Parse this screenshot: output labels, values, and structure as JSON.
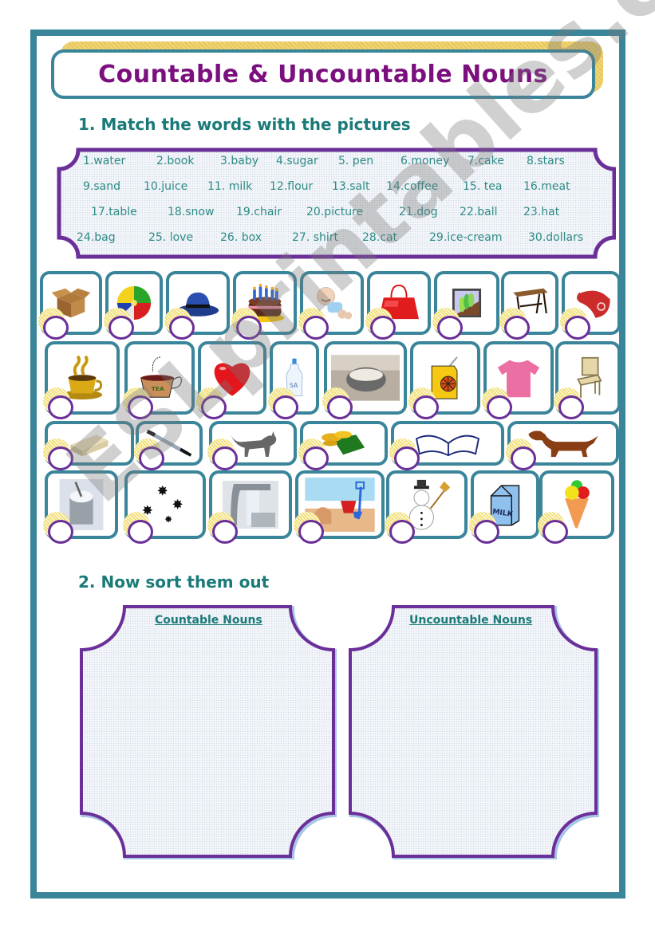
{
  "title": "Countable & Uncountable Nouns",
  "section1": {
    "heading": "1. Match the words with the pictures",
    "words": [
      [
        "1.water",
        "2.book",
        "3.baby",
        "4.sugar",
        "5. pen",
        "6.money",
        "7.cake",
        "8.stars"
      ],
      [
        "9.sand",
        "10.juice",
        "11. milk",
        "12.flour",
        "13.salt",
        "14.coffee",
        "15. tea",
        "16.meat"
      ],
      [
        "17.table",
        "18.snow",
        "19.chair",
        "20.picture",
        "21.dog",
        "22.ball",
        "23.hat"
      ],
      [
        "24.bag",
        "25. love",
        "26. box",
        "27. shirt",
        "28.cat",
        "29.ice-cream",
        "30.dollars"
      ]
    ],
    "pictures": [
      {
        "id": "box",
        "label": "box"
      },
      {
        "id": "ball",
        "label": "ball"
      },
      {
        "id": "hat",
        "label": "hat"
      },
      {
        "id": "cake",
        "label": "cake"
      },
      {
        "id": "baby",
        "label": "baby"
      },
      {
        "id": "bag",
        "label": "bag"
      },
      {
        "id": "picture",
        "label": "picture"
      },
      {
        "id": "table",
        "label": "table"
      },
      {
        "id": "meat",
        "label": "meat"
      },
      {
        "id": "coffee",
        "label": "coffee"
      },
      {
        "id": "tea",
        "label": "tea",
        "text": "TEA"
      },
      {
        "id": "love",
        "label": "love"
      },
      {
        "id": "salt",
        "label": "salt",
        "text": "SA"
      },
      {
        "id": "flour",
        "label": "flour"
      },
      {
        "id": "juice",
        "label": "juice"
      },
      {
        "id": "shirt",
        "label": "shirt"
      },
      {
        "id": "chair",
        "label": "chair"
      },
      {
        "id": "dollars",
        "label": "dollars"
      },
      {
        "id": "pen",
        "label": "pen"
      },
      {
        "id": "cat",
        "label": "cat"
      },
      {
        "id": "money",
        "label": "money"
      },
      {
        "id": "book",
        "label": "book"
      },
      {
        "id": "dog",
        "label": "dog"
      },
      {
        "id": "sugar",
        "label": "sugar"
      },
      {
        "id": "stars",
        "label": "stars"
      },
      {
        "id": "water",
        "label": "water"
      },
      {
        "id": "sand",
        "label": "sand"
      },
      {
        "id": "snow",
        "label": "snow"
      },
      {
        "id": "milk",
        "label": "milk",
        "text": "MILK"
      },
      {
        "id": "ice-cream",
        "label": "ice-cream"
      }
    ]
  },
  "section2": {
    "heading": "2. Now sort them out",
    "countable_label": "Countable Nouns",
    "uncountable_label": "Uncountable Nouns"
  },
  "watermark": "ESLprintables.com",
  "colors": {
    "frame": "#3a8599",
    "title": "#7b0f7e",
    "heading": "#1a7a78",
    "purple": "#6a2f98"
  }
}
